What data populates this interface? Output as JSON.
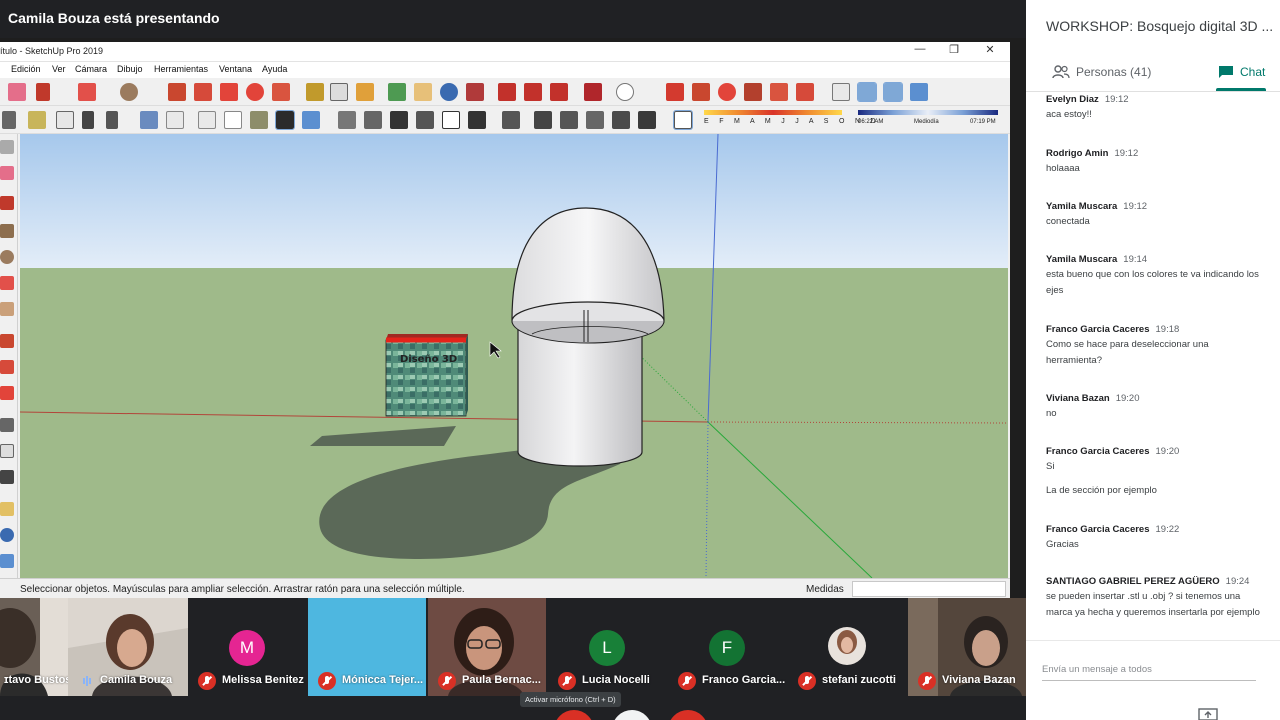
{
  "presenter": {
    "label": "Camila Bouza está presentando"
  },
  "sketchup": {
    "window_title": "ítulo - SketchUp Pro 2019",
    "menu": [
      "Edición",
      "Ver",
      "Cámara",
      "Dibujo",
      "Herramientas",
      "Ventana",
      "Ayuda"
    ],
    "shadow": {
      "months": "E F M A M J J A S O N D",
      "time_start": "06:22 AM",
      "time_mid": "Mediodía",
      "time_end": "07:19 PM"
    },
    "model_text": "Diseño 3D",
    "status_text": "Seleccionar objetos. Mayúsculas para ampliar selección. Arrastrar ratón para una selección múltiple.",
    "measurements_label": "Medidas"
  },
  "panel": {
    "title": "WORKSHOP: Bosquejo digital 3D ...",
    "tab_people": "Personas (41)",
    "tab_chat": "Chat",
    "composer_placeholder": "Envía un mensaje a todos"
  },
  "chat": [
    {
      "name": "Evelyn Diaz",
      "time": "19:12",
      "lines": [
        "aca estoy!!"
      ]
    },
    {
      "name": "Rodrigo Amin",
      "time": "19:12",
      "lines": [
        "holaaaa"
      ]
    },
    {
      "name": "Yamila Muscara",
      "time": "19:12",
      "lines": [
        "conectada"
      ]
    },
    {
      "name": "Yamila Muscara",
      "time": "19:14",
      "lines": [
        "esta bueno que con los colores te va indicando los",
        "ejes"
      ]
    },
    {
      "name": "Franco Garcia Caceres",
      "time": "19:18",
      "lines": [
        "Como se hace para deseleccionar una",
        "herramienta?"
      ]
    },
    {
      "name": "Viviana Bazan",
      "time": "19:20",
      "lines": [
        "no"
      ]
    },
    {
      "name": "Franco Garcia Caceres",
      "time": "19:20",
      "lines": [
        "Si"
      ],
      "extra": "La de sección por ejemplo"
    },
    {
      "name": "Franco Garcia Caceres",
      "time": "19:22",
      "lines": [
        "Gracias"
      ]
    },
    {
      "name": "SANTIAGO GABRIEL PEREZ AGÜERO",
      "time": "19:24",
      "lines": [
        "se pueden insertar .stl u .obj ? si tenemos una",
        "marca ya hecha y queremos insertarla por ejemplo"
      ]
    }
  ],
  "participants": [
    {
      "name": "ɪtavo Bustos",
      "initial": "",
      "color": "#5b5149",
      "muted": false
    },
    {
      "name": "Camila Bouza",
      "initial": "",
      "color": "#8a7d74",
      "muted": false,
      "speaking": true
    },
    {
      "name": "Melissa Benitez",
      "initial": "M",
      "color": "#e52592",
      "muted": true
    },
    {
      "name": "Mónicca Tejer...",
      "initial": "",
      "color": "#4eb7e0",
      "muted": true
    },
    {
      "name": "Paula Bernac...",
      "initial": "",
      "color": "#6e4b43",
      "muted": true
    },
    {
      "name": "Lucia Nocelli",
      "initial": "L",
      "color": "#188038",
      "muted": true
    },
    {
      "name": "Franco Garcia...",
      "initial": "F",
      "color": "#137333",
      "muted": true
    },
    {
      "name": "stefani zucotti",
      "initial": "",
      "color": "#3c4043",
      "muted": true
    },
    {
      "name": "Viviana Bazan",
      "initial": "",
      "color": "#54463c",
      "muted": true
    }
  ],
  "tooltip": "Activar micrófono (Ctrl + D)",
  "colors": {
    "sky_top": "#a6c8ec",
    "ground": "#9fba8a",
    "meet_accent": "#00796b",
    "mute_red": "#d93025"
  }
}
